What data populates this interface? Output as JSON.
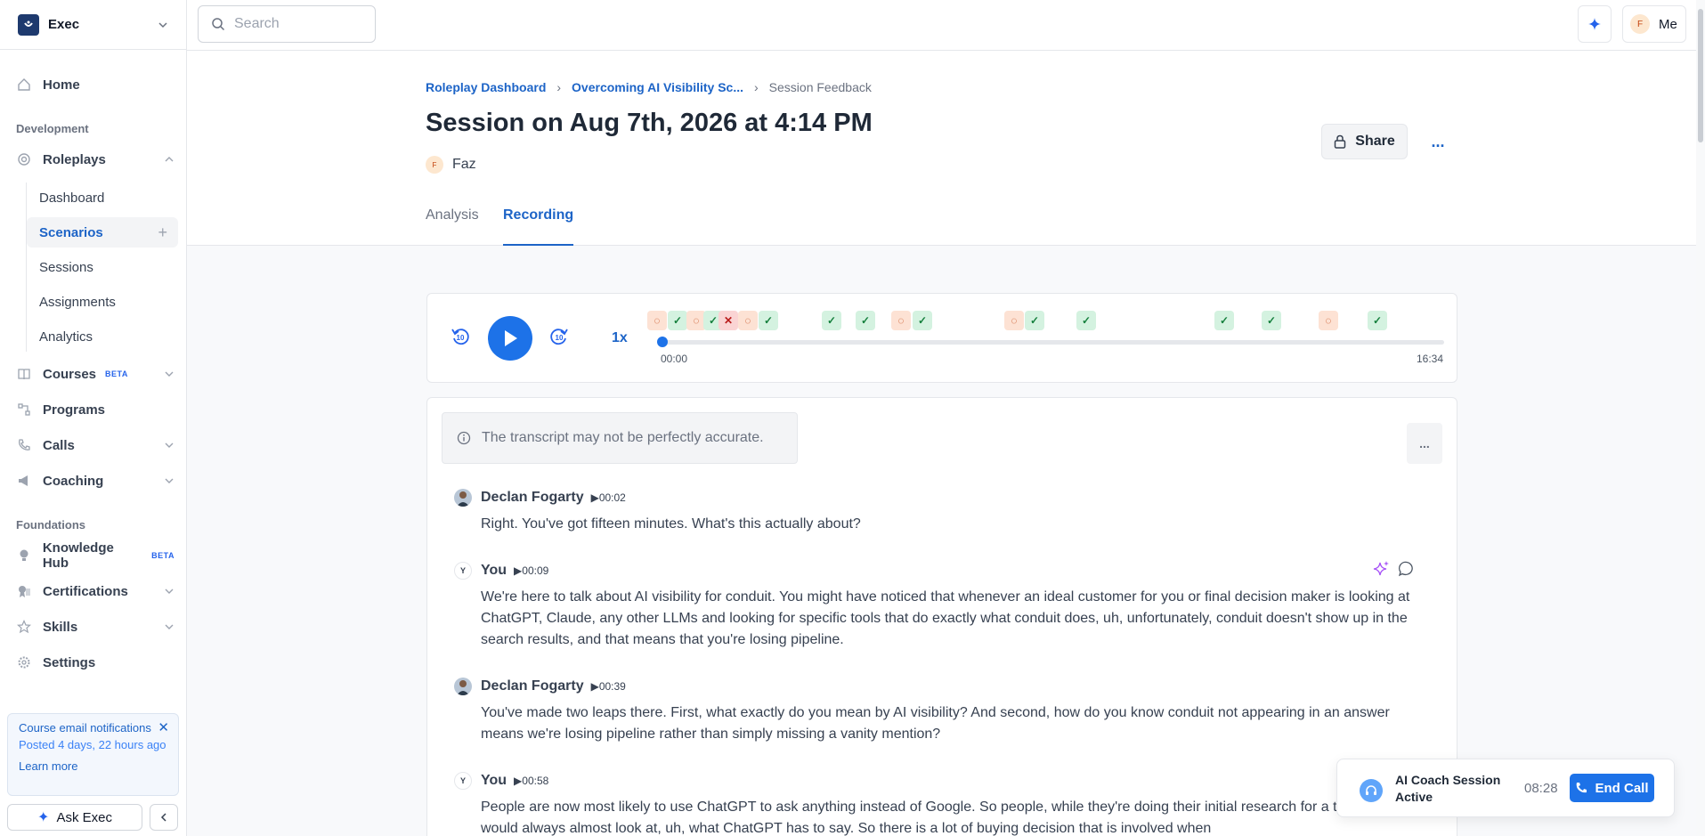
{
  "sidebar": {
    "org_name": "Exec",
    "nav_top": [
      {
        "label": "Home"
      }
    ],
    "sections": {
      "development": "Development",
      "foundations": "Foundations"
    },
    "roleplays": {
      "label": "Roleplays"
    },
    "roleplay_subitems": [
      {
        "label": "Dashboard"
      },
      {
        "label": "Scenarios"
      },
      {
        "label": "Sessions"
      },
      {
        "label": "Assignments"
      },
      {
        "label": "Analytics"
      }
    ],
    "dev_items": [
      {
        "label": "Courses",
        "badge": "BETA"
      },
      {
        "label": "Programs"
      },
      {
        "label": "Calls"
      },
      {
        "label": "Coaching"
      }
    ],
    "foundation_items": [
      {
        "label": "Knowledge Hub",
        "badge": "BETA"
      },
      {
        "label": "Certifications"
      },
      {
        "label": "Skills"
      },
      {
        "label": "Settings"
      }
    ],
    "notification": {
      "title": "Course email notifications",
      "posted": "Posted 4 days, 22 hours ago",
      "link": "Learn more"
    },
    "ask_button": "Ask Exec"
  },
  "topbar": {
    "search_placeholder": "Search",
    "user_initial": "F",
    "user_label": "Me"
  },
  "header": {
    "breadcrumbs": [
      "Roleplay Dashboard",
      "Overcoming AI Visibility Sc...",
      "Session Feedback"
    ],
    "title": "Session on Aug 7th, 2026 at 4:14 PM",
    "owner_initial": "F",
    "owner": "Faz",
    "share_label": "Share",
    "more_label": "...",
    "tabs": [
      {
        "label": "Analysis"
      },
      {
        "label": "Recording"
      }
    ]
  },
  "player": {
    "speed": "1x",
    "current_time": "00:00",
    "duration": "16:34",
    "progress": 0
  },
  "transcript": {
    "disclaimer": "The transcript may not be perfectly accurate.",
    "more_label": "...",
    "messages": [
      {
        "speaker": "Declan Fogarty",
        "time": "00:02",
        "avatar": "",
        "text": "Right. You've got fifteen minutes. What's this actually about?"
      },
      {
        "speaker": "You",
        "time": "00:09",
        "avatar": "Y",
        "text": "We're here to talk about AI visibility for conduit. You might have noticed that whenever an ideal customer for you or final decision maker is looking at ChatGPT, Claude, any other LLMs and looking for specific tools that do exactly what conduit does, uh, unfortunately, conduit doesn't show up in the search results, and that means that you're losing pipeline."
      },
      {
        "speaker": "Declan Fogarty",
        "time": "00:39",
        "avatar": "",
        "text": "You've made two leaps there. First, what exactly do you mean by AI visibility? And second, how do you know conduit not appearing in an answer means we're losing pipeline rather than simply missing a vanity mention?"
      },
      {
        "speaker": "You",
        "time": "00:58",
        "avatar": "Y",
        "text": "People are now most likely to use ChatGPT to ask anything instead of Google. So people, while they're doing their initial research for a tool like this would always almost look at, uh, what ChatGPT has to say. So there is a lot of buying decision that is involved when"
      }
    ]
  },
  "coach": {
    "title": "AI Coach Session Active",
    "timer": "08:28",
    "end_label": "End Call"
  },
  "colors": {
    "accent": "#1d72e8",
    "link": "#1d64c7",
    "check_bg": "#d4f2e0",
    "dash_bg": "#fde2d4",
    "cross_bg": "#fad4d4"
  }
}
